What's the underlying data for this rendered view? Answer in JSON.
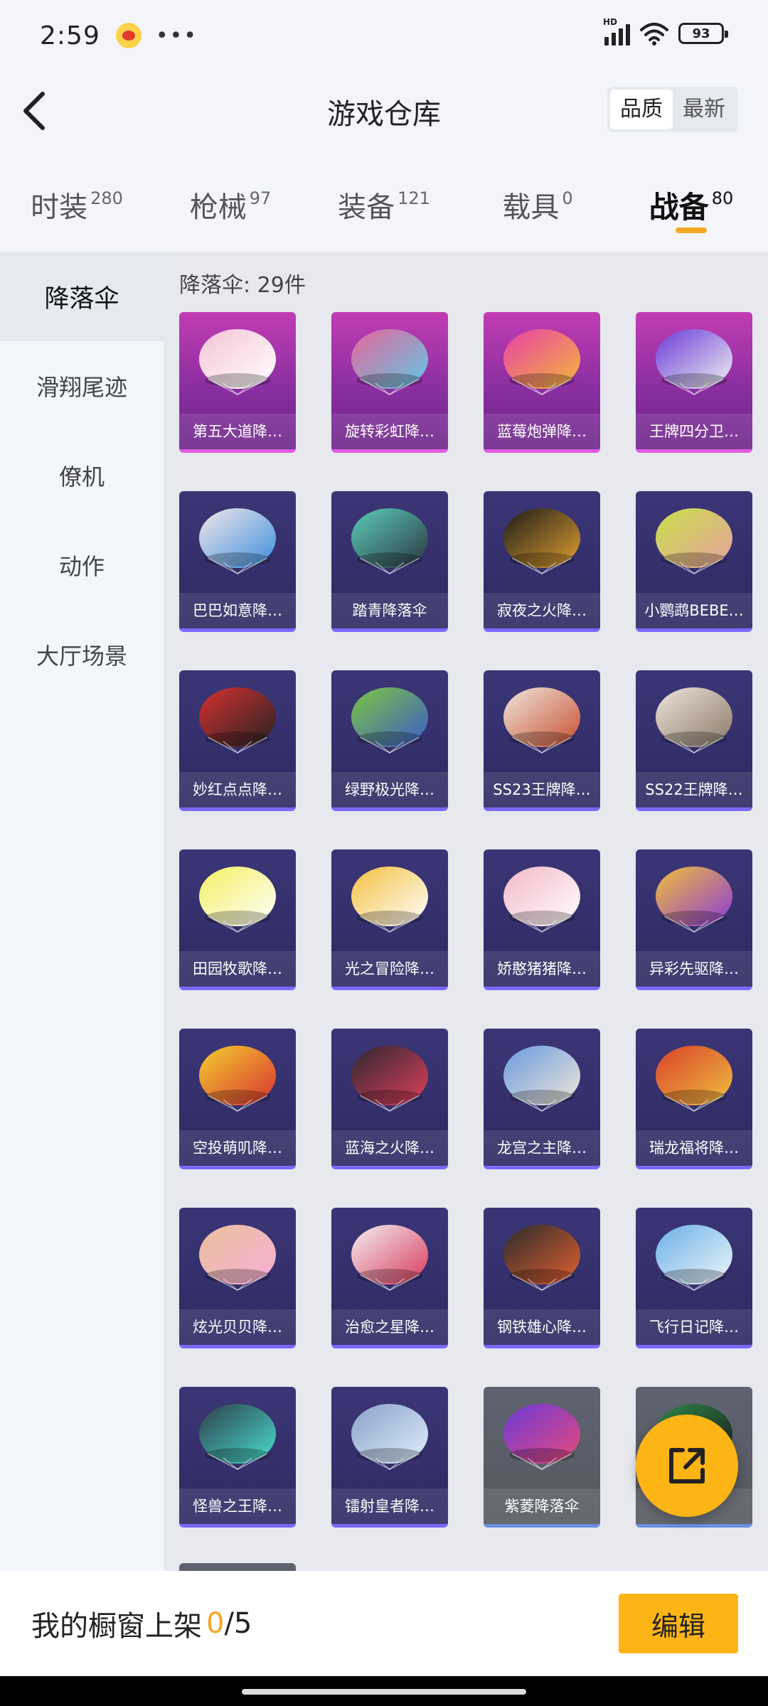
{
  "status": {
    "time": "2:59",
    "battery": "93"
  },
  "header": {
    "title": "游戏仓库",
    "sort": [
      "品质",
      "最新"
    ]
  },
  "tabs": [
    {
      "label": "时装",
      "count": "280"
    },
    {
      "label": "枪械",
      "count": "97"
    },
    {
      "label": "装备",
      "count": "121"
    },
    {
      "label": "载具",
      "count": "0"
    },
    {
      "label": "战备",
      "count": "80",
      "active": true
    }
  ],
  "sidebar": {
    "items": [
      "降落伞",
      "滑翔尾迹",
      "僚机",
      "动作",
      "大厅场景"
    ]
  },
  "section": {
    "title": "降落伞: 29件"
  },
  "items": [
    {
      "name": "第五大道降…",
      "quality": "purple",
      "c1": "#f4c4d6",
      "c2": "#ffffff"
    },
    {
      "name": "旋转彩虹降…",
      "quality": "purple",
      "c1": "#e8649a",
      "c2": "#5ec9e6"
    },
    {
      "name": "蓝莓炮弹降…",
      "quality": "purple",
      "c1": "#e83fa8",
      "c2": "#f5b93a"
    },
    {
      "name": "王牌四分卫…",
      "quality": "purple",
      "c1": "#6a3ad8",
      "c2": "#f2f2f2"
    },
    {
      "name": "巴巴如意降…",
      "quality": "blue",
      "c1": "#f2e8e8",
      "c2": "#3d8fe0"
    },
    {
      "name": "踏青降落伞",
      "quality": "blue",
      "c1": "#5ccfb8",
      "c2": "#2a3440"
    },
    {
      "name": "寂夜之火降…",
      "quality": "blue",
      "c1": "#1a1a1a",
      "c2": "#e0a030"
    },
    {
      "name": "小鹦鹉BEBE…",
      "quality": "blue",
      "c1": "#c8e04a",
      "c2": "#e8a0a0"
    },
    {
      "name": "妙红点点降…",
      "quality": "blue",
      "c1": "#d63030",
      "c2": "#222222"
    },
    {
      "name": "绿野极光降…",
      "quality": "blue",
      "c1": "#7cc840",
      "c2": "#3a5ac8"
    },
    {
      "name": "SS23王牌降…",
      "quality": "blue",
      "c1": "#f0e6dc",
      "c2": "#c85030"
    },
    {
      "name": "SS22王牌降…",
      "quality": "blue",
      "c1": "#ede4d8",
      "c2": "#8a7a6a"
    },
    {
      "name": "田园牧歌降…",
      "quality": "blue",
      "c1": "#f2f060",
      "c2": "#ffffff"
    },
    {
      "name": "光之冒险降…",
      "quality": "blue",
      "c1": "#f5c040",
      "c2": "#ffffff"
    },
    {
      "name": "娇憨猪猪降…",
      "quality": "blue",
      "c1": "#f4b8c8",
      "c2": "#ffffff"
    },
    {
      "name": "异彩先驱降…",
      "quality": "blue",
      "c1": "#f2c03a",
      "c2": "#8a3ad8"
    },
    {
      "name": "空投萌叽降…",
      "quality": "blue",
      "c1": "#f5d030",
      "c2": "#d83030"
    },
    {
      "name": "蓝海之火降…",
      "quality": "blue",
      "c1": "#2a2630",
      "c2": "#e0405a"
    },
    {
      "name": "龙宫之主降…",
      "quality": "blue",
      "c1": "#6a9ae0",
      "c2": "#f0e8d8"
    },
    {
      "name": "瑞龙福将降…",
      "quality": "blue",
      "c1": "#d8402a",
      "c2": "#f0c040"
    },
    {
      "name": "炫光贝贝降…",
      "quality": "blue",
      "c1": "#e8c09a",
      "c2": "#f8b0d8"
    },
    {
      "name": "治愈之星降…",
      "quality": "blue",
      "c1": "#f4f0f4",
      "c2": "#d83a5a"
    },
    {
      "name": "钢铁雄心降…",
      "quality": "blue",
      "c1": "#2a2a2a",
      "c2": "#e06030"
    },
    {
      "name": "飞行日记降…",
      "quality": "blue",
      "c1": "#6ab0e8",
      "c2": "#f0f6fa"
    },
    {
      "name": "怪兽之王降…",
      "quality": "blue",
      "c1": "#2c3c48",
      "c2": "#4ae0d0"
    },
    {
      "name": "镭射皇者降…",
      "quality": "blue",
      "c1": "#8aa0c8",
      "c2": "#e0f0ff"
    },
    {
      "name": "紫菱降落伞",
      "quality": "grey",
      "c1": "#6a3ad8",
      "c2": "#e84a7a"
    },
    {
      "name": "",
      "quality": "grey",
      "c1": "#2e8a4a",
      "c2": "#1a1a1a"
    }
  ],
  "bottom": {
    "label": "我的橱窗上架",
    "count": "0",
    "total": "/5",
    "edit": "编辑"
  }
}
